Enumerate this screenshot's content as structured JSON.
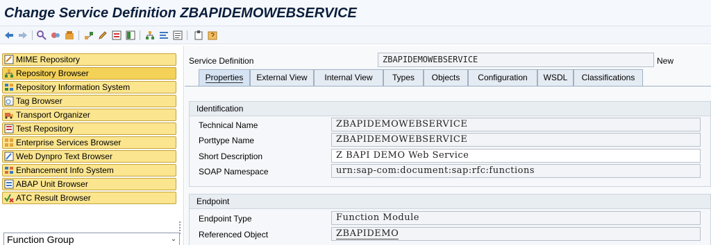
{
  "window": {
    "title": "Change Service Definition ZBAPIDEMOWEBSERVICE"
  },
  "toolbar": {
    "icons": [
      "back-arrow-icon",
      "forward-arrow-icon",
      "toggle-display-change-icon",
      "activate-icon",
      "other-object-icon",
      "where-used-icon",
      "edit-pencil-icon",
      "display-object-list-icon",
      "navigation-window-icon",
      "hierarchy-icon",
      "align-icon",
      "info-icon",
      "clipboard-icon",
      "help-icon"
    ]
  },
  "sidebar": {
    "items": [
      {
        "label": "MIME Repository",
        "icon": "mime-repository-icon"
      },
      {
        "label": "Repository Browser",
        "icon": "repository-browser-icon"
      },
      {
        "label": "Repository Information System",
        "icon": "repository-info-system-icon"
      },
      {
        "label": "Tag Browser",
        "icon": "tag-browser-icon"
      },
      {
        "label": "Transport Organizer",
        "icon": "transport-organizer-icon"
      },
      {
        "label": "Test Repository",
        "icon": "test-repository-icon"
      },
      {
        "label": "Enterprise Services Browser",
        "icon": "enterprise-services-icon"
      },
      {
        "label": "Web Dynpro Text Browser",
        "icon": "web-dynpro-text-icon"
      },
      {
        "label": "Enhancement Info System",
        "icon": "enhancement-info-icon"
      },
      {
        "label": "ABAP Unit Browser",
        "icon": "abap-unit-icon"
      },
      {
        "label": "ATC Result Browser",
        "icon": "atc-result-icon"
      }
    ],
    "object_type_select": {
      "value": "Function Group"
    }
  },
  "header": {
    "service_definition_label": "Service Definition",
    "service_definition_value": "ZBAPIDEMOWEBSERVICE",
    "status": "New"
  },
  "tabs": [
    {
      "label": "Properties",
      "active": true
    },
    {
      "label": "External View",
      "active": false
    },
    {
      "label": "Internal View",
      "active": false
    },
    {
      "label": "Types",
      "active": false
    },
    {
      "label": "Objects",
      "active": false
    },
    {
      "label": "Configuration",
      "active": false
    },
    {
      "label": "WSDL",
      "active": false
    },
    {
      "label": "Classifications",
      "active": false
    }
  ],
  "identification": {
    "title": "Identification",
    "rows": [
      {
        "label": "Technical Name",
        "value": "ZBAPIDEMOWEBSERVICE"
      },
      {
        "label": "Porttype Name",
        "value": "ZBAPIDEMOWEBSERVICE"
      },
      {
        "label": "Short Description",
        "value": "Z BAPI DEMO Web Service"
      },
      {
        "label": "SOAP Namespace",
        "value": "urn:sap-com:document:sap:rfc:functions"
      }
    ]
  },
  "endpoint": {
    "title": "Endpoint",
    "rows": [
      {
        "label": "Endpoint Type",
        "value": "Function Module"
      },
      {
        "label": "Referenced Object",
        "value": "ZBAPIDEMO"
      }
    ]
  },
  "colors": {
    "nav_button": "#fbe58e",
    "nav_button_active": "#f4d157",
    "title_text": "#0b1e3c",
    "tab_active": "#d6e3f3"
  }
}
